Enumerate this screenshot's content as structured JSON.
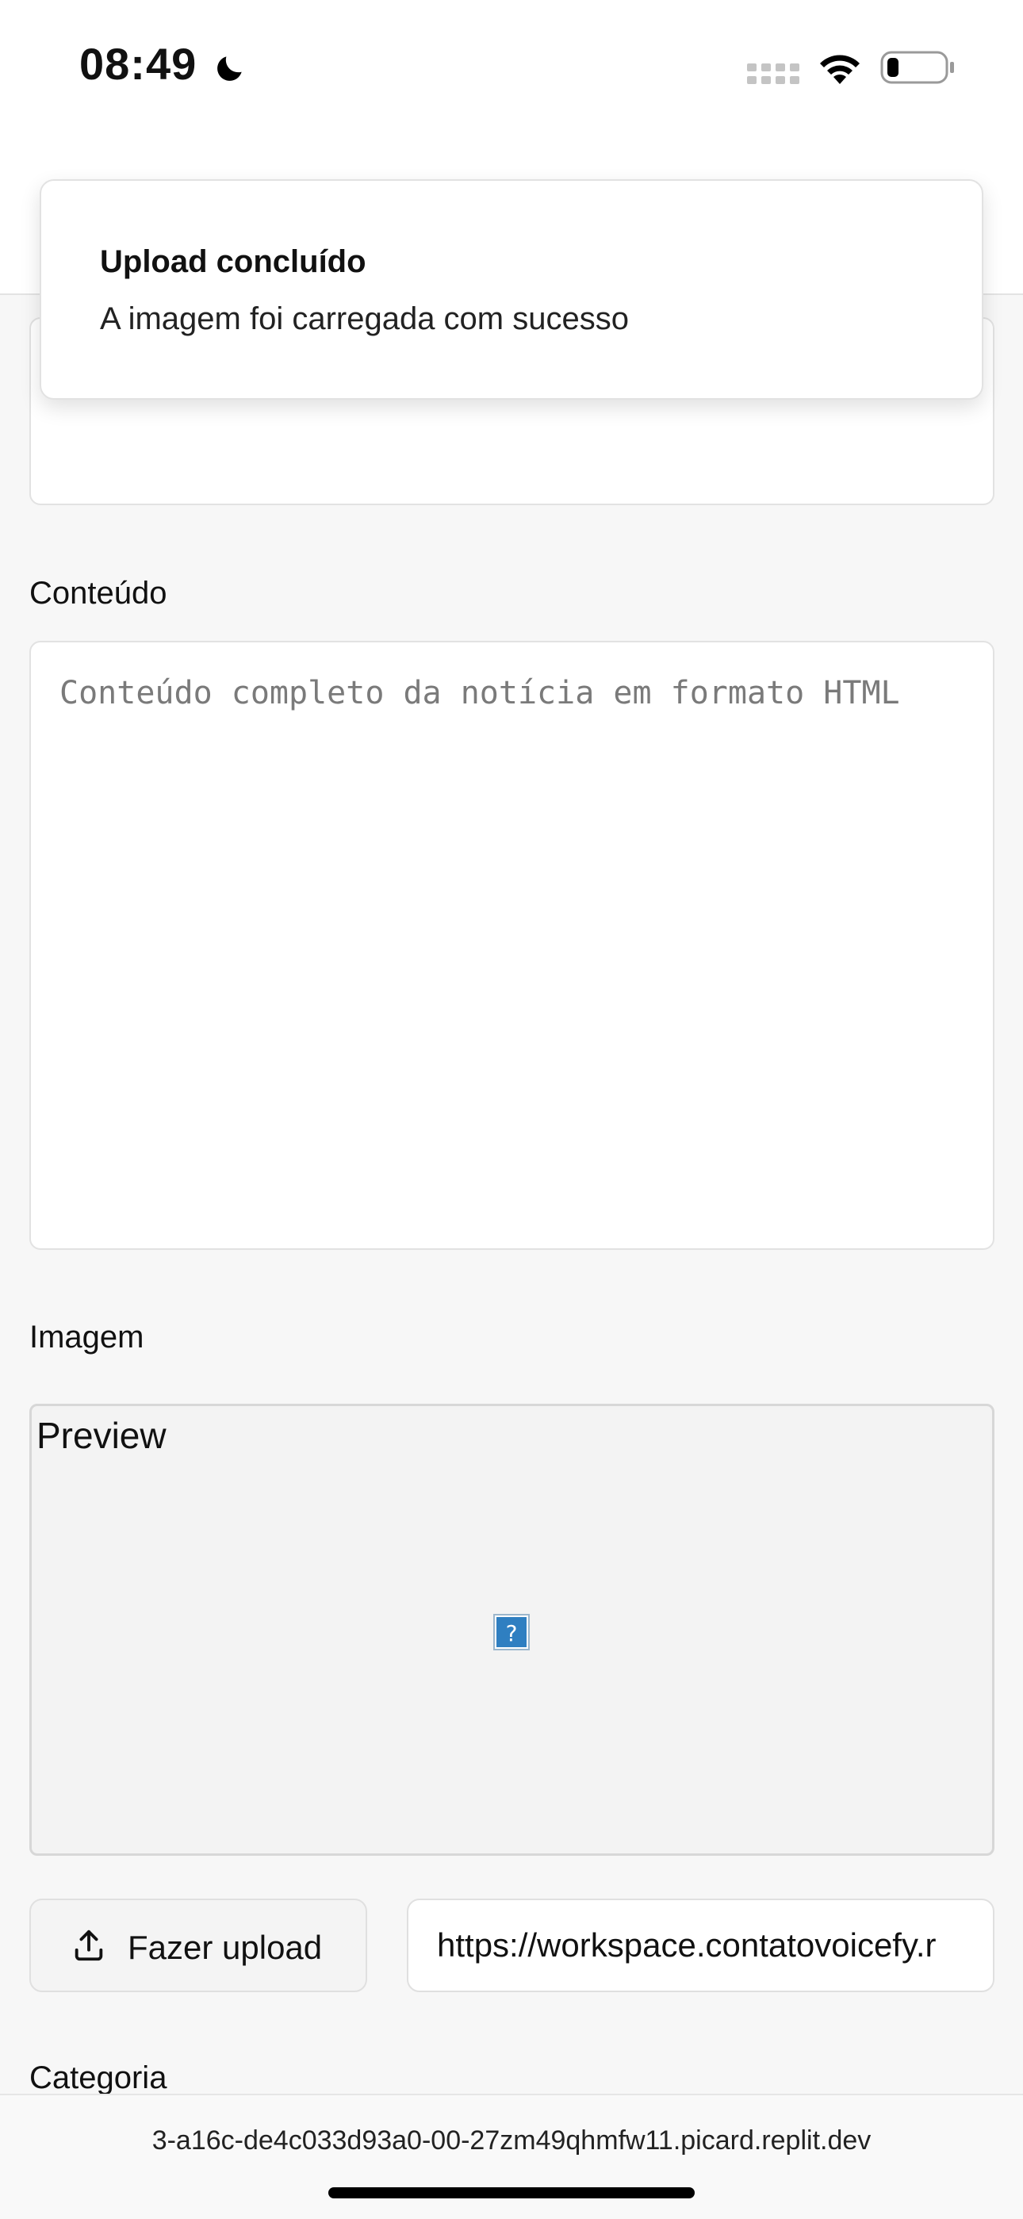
{
  "status_bar": {
    "time": "08:49"
  },
  "toast": {
    "title": "Upload concluído",
    "description": "A imagem foi carregada com sucesso"
  },
  "form": {
    "content_label": "Conteúdo",
    "content_placeholder": "Conteúdo completo da notícia em formato HTML",
    "image_label": "Imagem",
    "preview_text": "Preview",
    "upload_button_label": "Fazer upload",
    "image_url_value": "https://workspace.contatovoicefy.r",
    "category_label": "Categoria"
  },
  "browser": {
    "url": "3-a16c-de4c033d93a0-00-27zm49qhmfw11.picard.replit.dev"
  },
  "icons": {
    "moon": "moon-icon",
    "signal": "cellular-signal-icon",
    "wifi": "wifi-icon",
    "battery": "battery-icon",
    "upload": "upload-icon",
    "broken_image": "broken-image-icon"
  }
}
